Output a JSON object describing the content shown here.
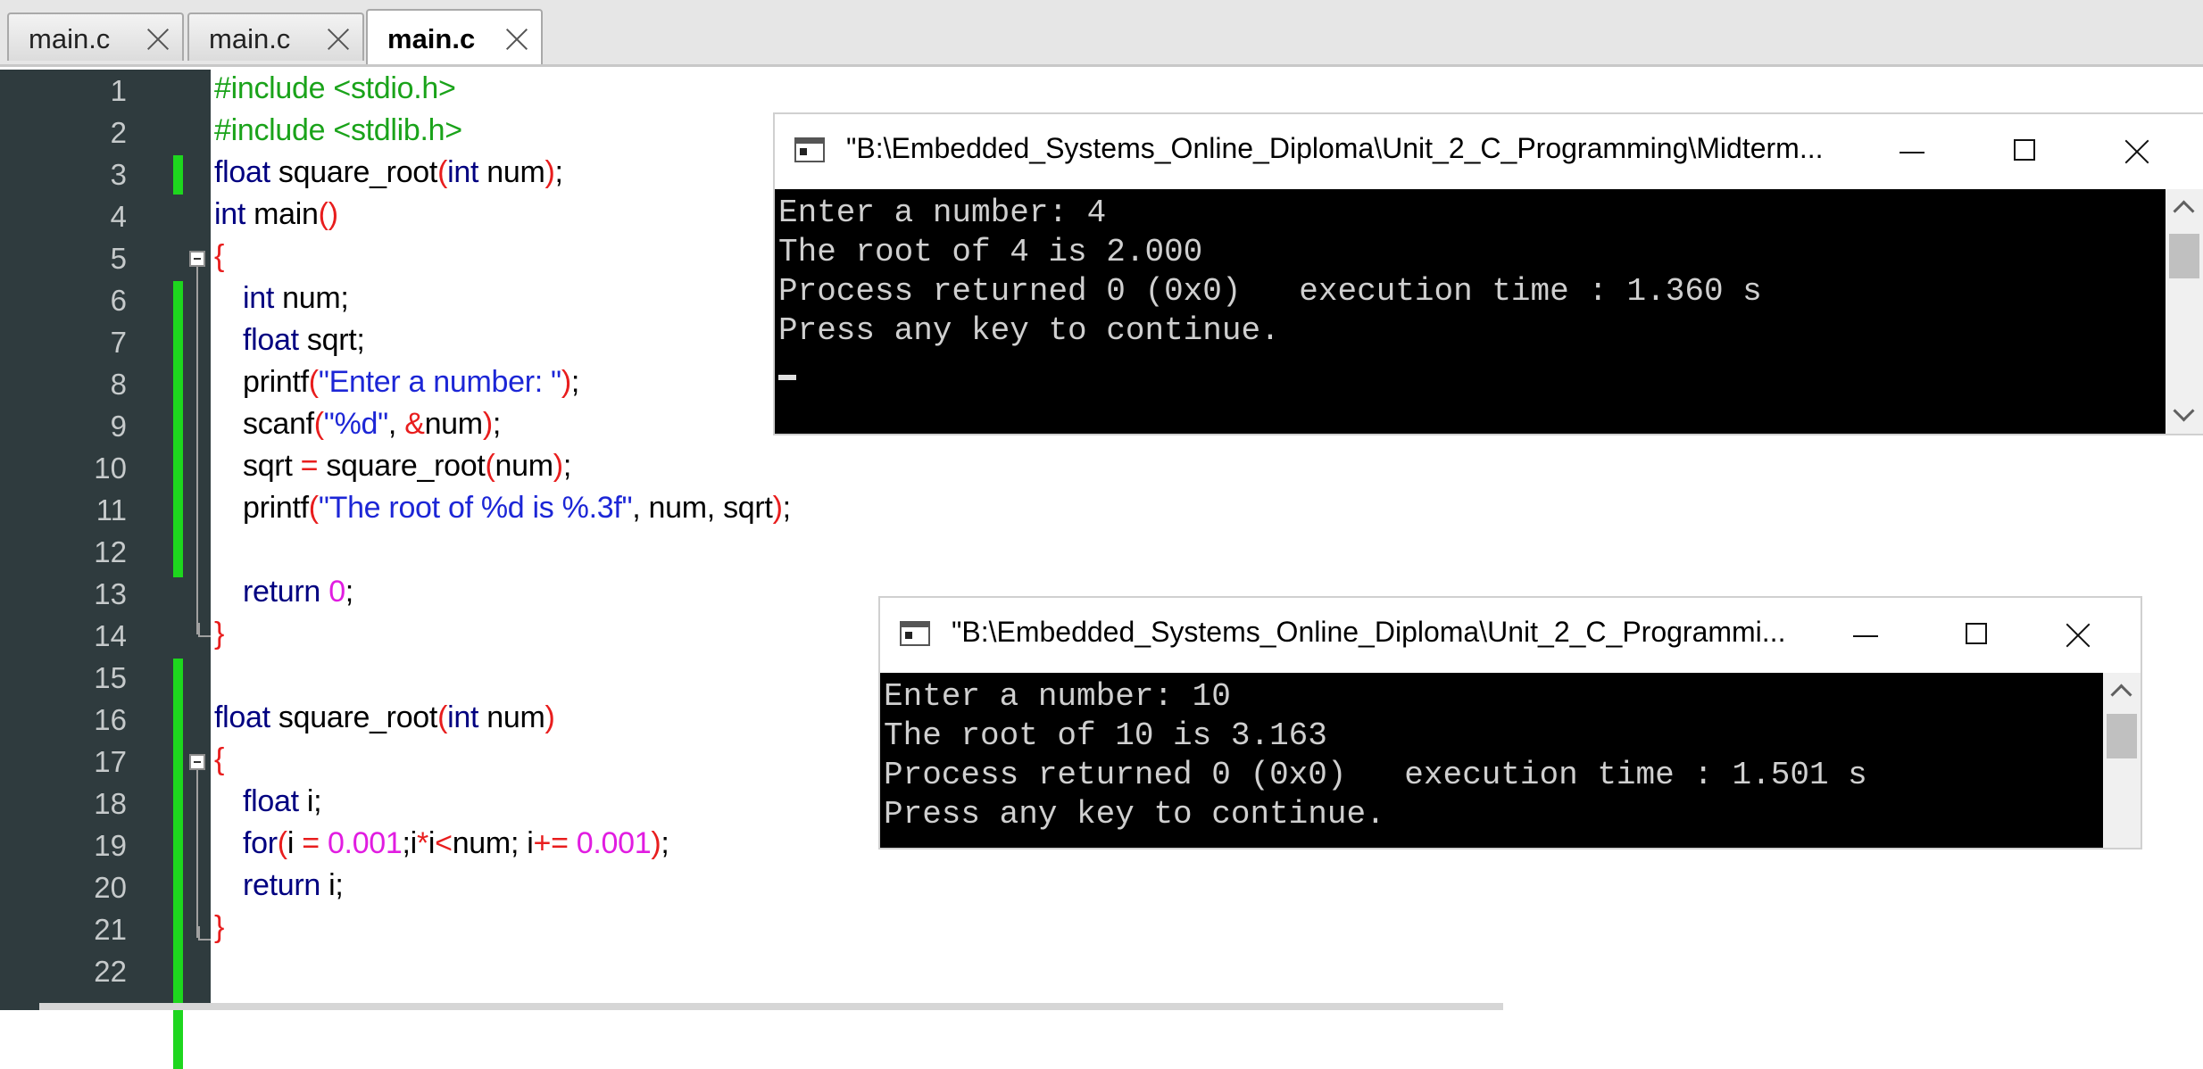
{
  "tabs": [
    {
      "label": "main.c",
      "active": false
    },
    {
      "label": "main.c",
      "active": false
    },
    {
      "label": "main.c",
      "active": true
    }
  ],
  "editor": {
    "line_numbers": [
      "1",
      "2",
      "3",
      "4",
      "5",
      "6",
      "7",
      "8",
      "9",
      "10",
      "11",
      "12",
      "13",
      "14",
      "15",
      "16",
      "17",
      "18",
      "19",
      "20",
      "21",
      "22"
    ],
    "lines": [
      "#include <stdio.h>",
      "#include <stdlib.h>",
      "float square_root(int num);",
      "int main()",
      "{",
      "int num;",
      "float sqrt;",
      "printf(\"Enter a number: \");",
      "scanf(\"%d\", &num);",
      "sqrt = square_root(num);",
      "printf(\"The root of %d is %.3f\", num, sqrt);",
      "",
      "return 0;",
      "}",
      "",
      "float square_root(int num)",
      "{",
      "float i;",
      "for(i = 0.001;i*i<num; i+= 0.001);",
      "return i;",
      "}",
      ""
    ]
  },
  "console1": {
    "title": "\"B:\\Embedded_Systems_Online_Diploma\\Unit_2_C_Programming\\Midterm...",
    "lines": [
      "Enter a number: 4",
      "The root of 4 is 2.000",
      "Process returned 0 (0x0)   execution time : 1.360 s",
      "Press any key to continue."
    ]
  },
  "console2": {
    "title": "\"B:\\Embedded_Systems_Online_Diploma\\Unit_2_C_Programmi...",
    "lines": [
      "Enter a number: 10",
      "The root of 10 is 3.163",
      "Process returned 0 (0x0)   execution time : 1.501 s",
      "Press any key to continue."
    ]
  },
  "icons": {
    "tab_close": "close-icon",
    "console_app": "console-app-icon",
    "minimize": "minimize-icon",
    "maximize": "maximize-icon",
    "close": "close-icon"
  },
  "colors": {
    "preprocessor": "#1aa31a",
    "keyword": "#000080",
    "string": "#1c26d6",
    "number": "#e11ce1",
    "operator": "#e81d1d",
    "gutter_bg": "#2f3b3e",
    "change_marker": "#1ed61e"
  }
}
